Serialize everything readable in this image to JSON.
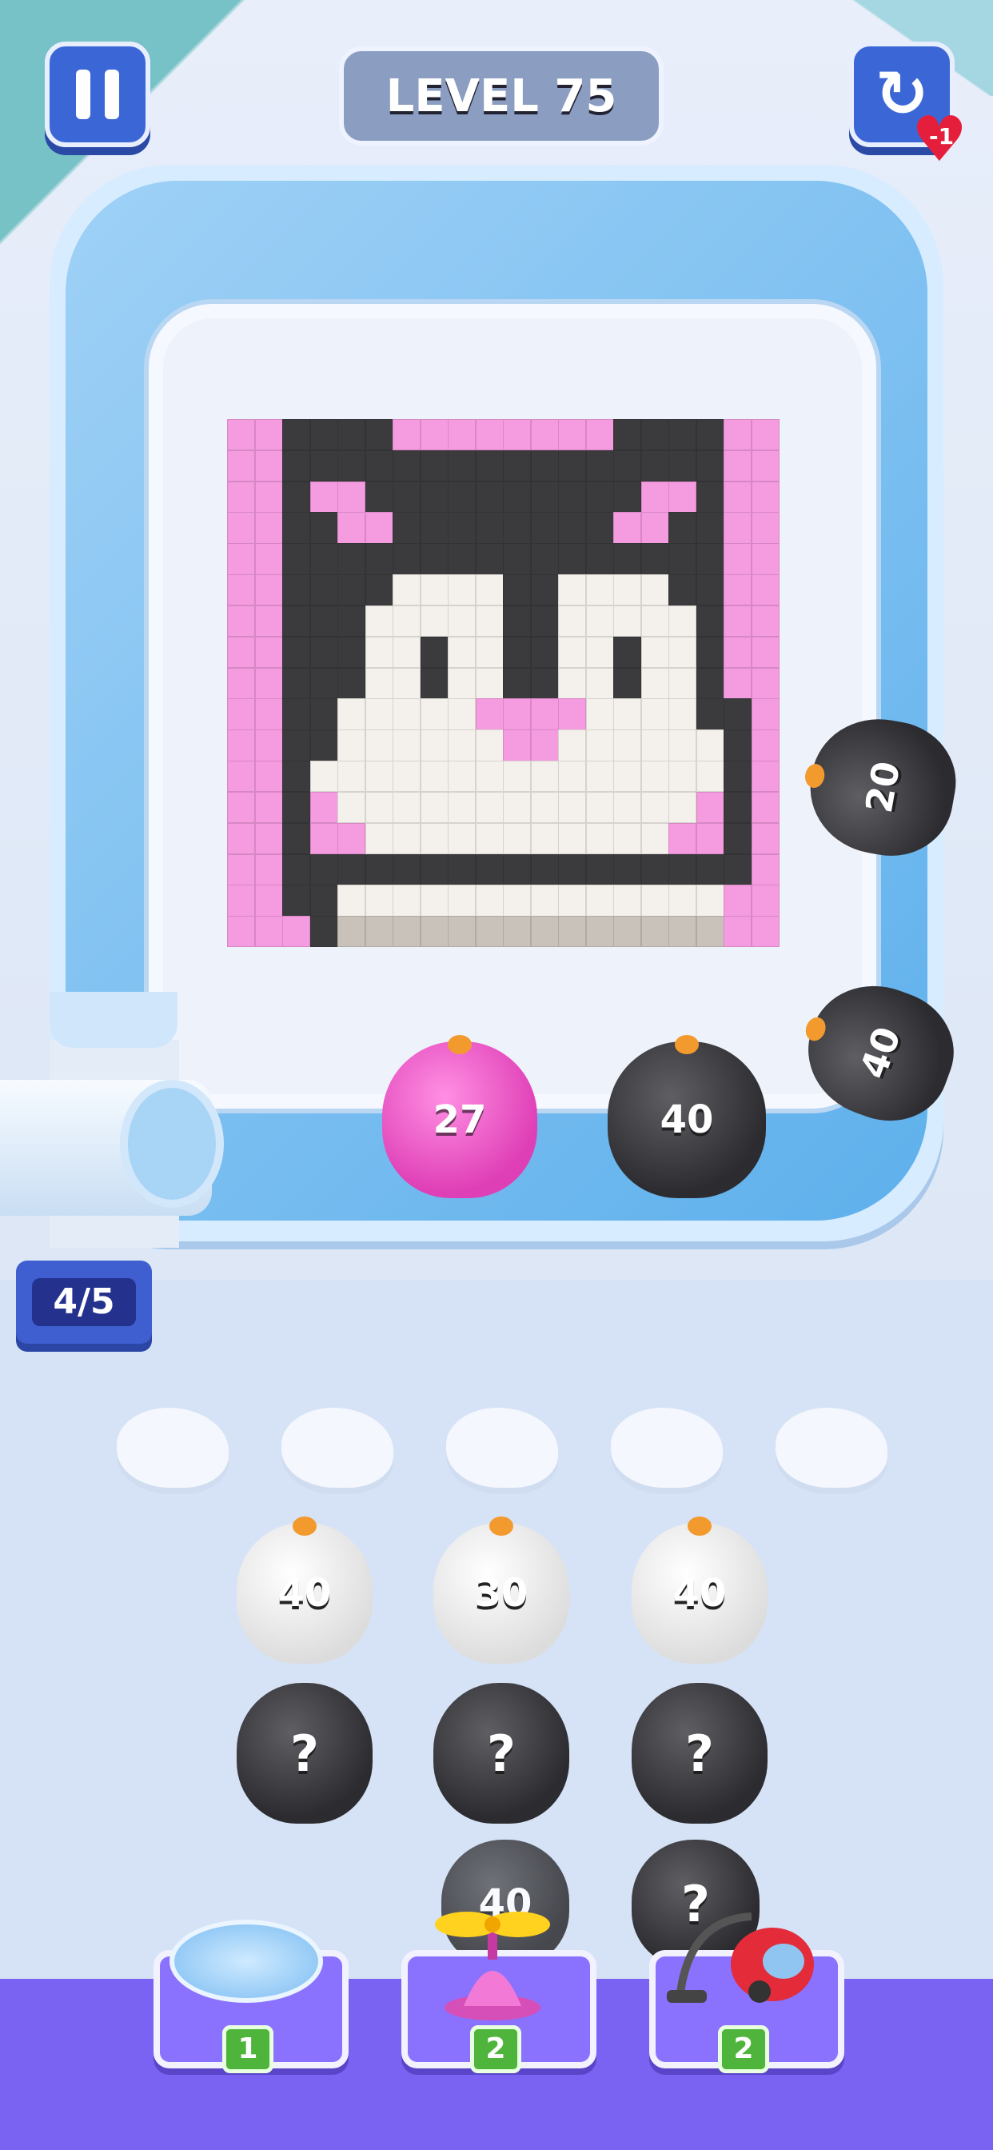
{
  "header": {
    "level_label": "LEVEL 75",
    "pause_icon": "pause-icon",
    "restart_icon": "restart-icon",
    "life_cost_label": "-1"
  },
  "board_pixels_rows": [
    "PPBBBBPPPPPPPPBBBBPP",
    "PPBBBBBBBBBBBBBBBBPP",
    "PPBPPBBBBBBBBBBPPBPP",
    "PPBBPPBBBBBBBBPPBBPP",
    "PPBBBBBBBBBBBBBBBBPP",
    "PPBBBBWWWWBBWWWWBBPP",
    "PPBBBWWWWWBBWWWWWBPP",
    "PPBBBWWBWWBBWWBWWBPP",
    "PPBBBWWBWWBBWWBWWBPP",
    "PPBBWWWWWPPPPWWWWBBP",
    "PPBBWWWWWWPPWWWWWWBP",
    "PPBWWWWWWWWWWWWWWWBP",
    "PPBPWWWWWWWWWWWWWPBP",
    "PPBPPWWWWWWWWWWWPPBP",
    "PPBBBBBBBBBBBBBBBBBP",
    "PPBBWWWWWWWWWWWWWWPP",
    "PPPBGGGGGGGGGGGGGGPP"
  ],
  "colors": {
    "P": "#f59be0",
    "B": "#3b3b3e",
    "W": "#f4f1ec",
    "G": "#c9c2ba"
  },
  "track_penguins": [
    {
      "color": "pink",
      "value": "27"
    },
    {
      "color": "black",
      "value": "40"
    },
    {
      "color": "black",
      "value": "40"
    },
    {
      "color": "black",
      "value": "20"
    }
  ],
  "queue_counter": "4/5",
  "waiting_slots": 5,
  "columns": [
    {
      "top": {
        "color": "white",
        "value": "40"
      },
      "hidden": [
        "?",
        "?"
      ]
    },
    {
      "top": {
        "color": "white",
        "value": "30"
      },
      "hidden": [
        "?",
        "40"
      ]
    },
    {
      "top": {
        "color": "white",
        "value": "40"
      },
      "hidden": [
        "?",
        "?"
      ]
    }
  ],
  "boosters": [
    {
      "name": "ice-trampoline",
      "count": "1"
    },
    {
      "name": "propeller",
      "count": "2"
    },
    {
      "name": "vacuum",
      "count": "2"
    }
  ]
}
